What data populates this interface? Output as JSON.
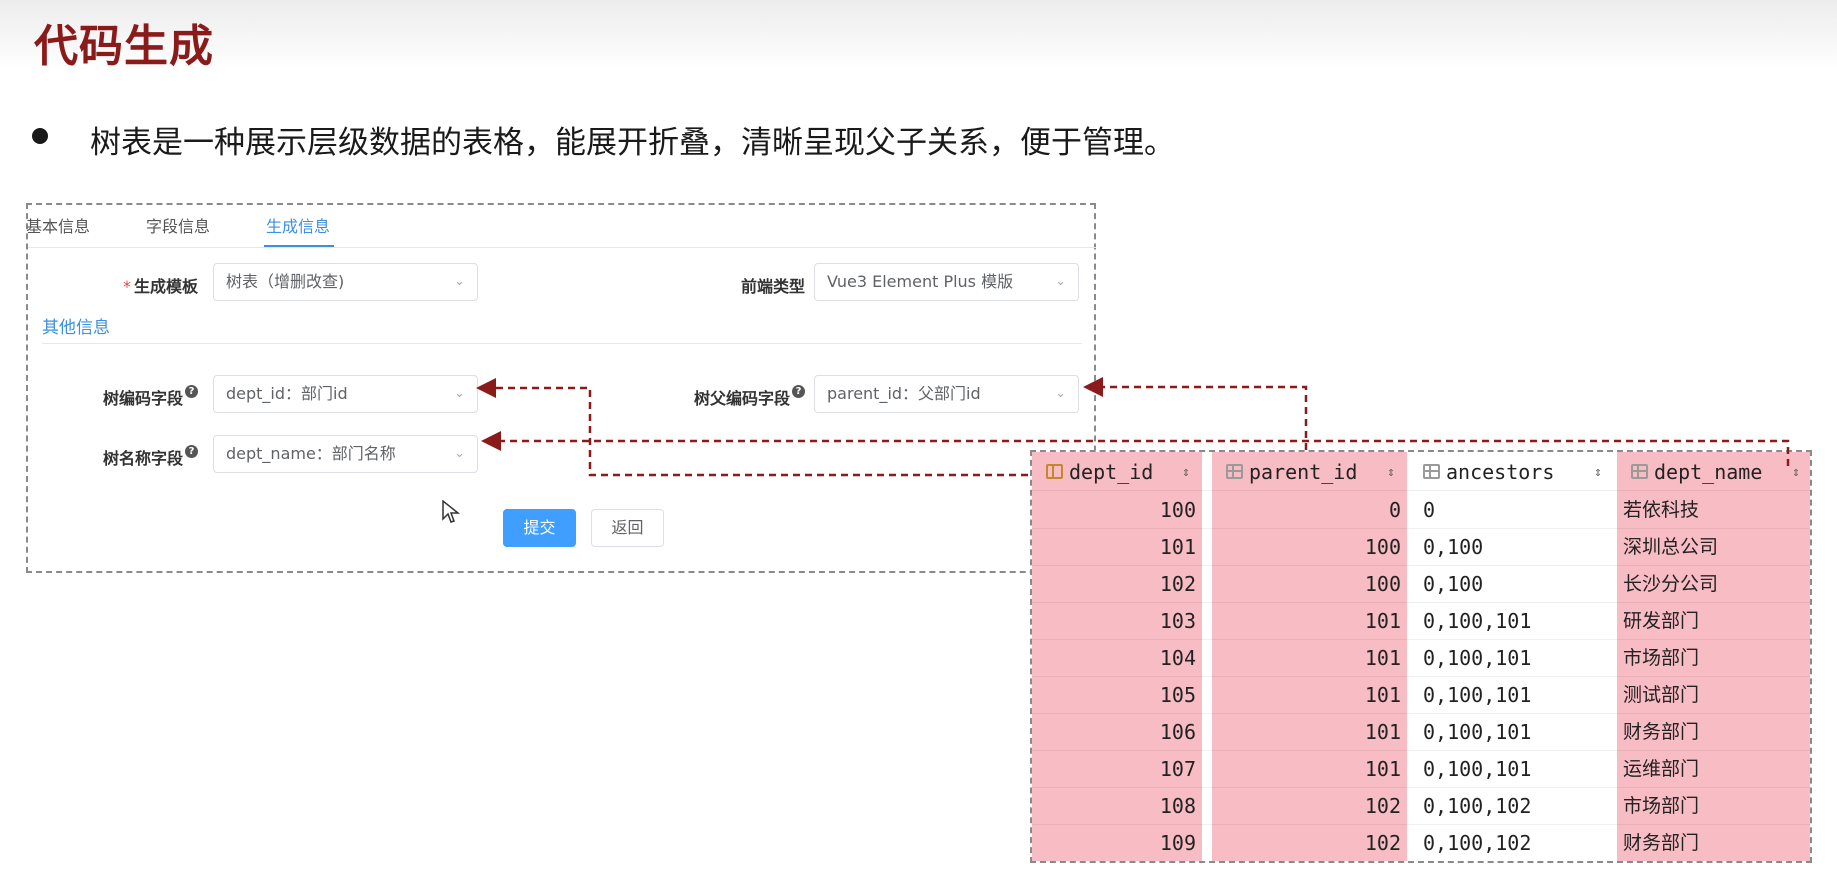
{
  "slide": {
    "title": "代码生成",
    "bullet": "树表是一种展示层级数据的表格，能展开折叠，清晰呈现父子关系，便于管理。"
  },
  "form": {
    "tabs": [
      {
        "label": "基本信息",
        "active": false
      },
      {
        "label": "字段信息",
        "active": false
      },
      {
        "label": "生成信息",
        "active": true
      }
    ],
    "template_label": "生成模板",
    "template_value": "树表（增删改查)",
    "frontend_label": "前端类型",
    "frontend_value": "Vue3 Element Plus 模版",
    "section_other": "其他信息",
    "tree_code_label": "树编码字段",
    "tree_code_value": "dept_id：部门id",
    "tree_parent_label": "树父编码字段",
    "tree_parent_value": "parent_id：父部门id",
    "tree_name_label": "树名称字段",
    "tree_name_value": "dept_name：部门名称",
    "submit_label": "提交",
    "back_label": "返回"
  },
  "db_table": {
    "columns": [
      "dept_id",
      "parent_id",
      "ancestors",
      "dept_name"
    ],
    "rows": [
      {
        "dept_id": "100",
        "parent_id": "0",
        "ancestors": "0",
        "dept_name": "若依科技"
      },
      {
        "dept_id": "101",
        "parent_id": "100",
        "ancestors": "0,100",
        "dept_name": "深圳总公司"
      },
      {
        "dept_id": "102",
        "parent_id": "100",
        "ancestors": "0,100",
        "dept_name": "长沙分公司"
      },
      {
        "dept_id": "103",
        "parent_id": "101",
        "ancestors": "0,100,101",
        "dept_name": "研发部门"
      },
      {
        "dept_id": "104",
        "parent_id": "101",
        "ancestors": "0,100,101",
        "dept_name": "市场部门"
      },
      {
        "dept_id": "105",
        "parent_id": "101",
        "ancestors": "0,100,101",
        "dept_name": "测试部门"
      },
      {
        "dept_id": "106",
        "parent_id": "101",
        "ancestors": "0,100,101",
        "dept_name": "财务部门"
      },
      {
        "dept_id": "107",
        "parent_id": "101",
        "ancestors": "0,100,101",
        "dept_name": "运维部门"
      },
      {
        "dept_id": "108",
        "parent_id": "102",
        "ancestors": "0,100,102",
        "dept_name": "市场部门"
      },
      {
        "dept_id": "109",
        "parent_id": "102",
        "ancestors": "0,100,102",
        "dept_name": "财务部门"
      }
    ],
    "highlight_color": "#f8bcc4"
  },
  "colors": {
    "title": "#8b1a1a",
    "accent": "#409eff",
    "arrow": "#8b1a1a"
  },
  "icons": [
    "primary-key-icon",
    "column-icon",
    "sort-icon",
    "chevron-down-icon",
    "help-icon",
    "cursor-icon",
    "arrow-icon"
  ]
}
